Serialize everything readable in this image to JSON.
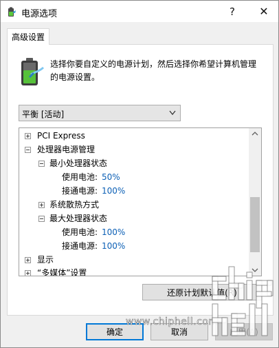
{
  "window": {
    "title": "电源选项",
    "help_glyph": "?",
    "close_glyph": "✕"
  },
  "tab": {
    "label": "高级设置"
  },
  "description": "选择你要自定义的电源计划，然后选择你希望计算机管理的电源设置。",
  "plan_dropdown": {
    "selected": "平衡 [活动]"
  },
  "tree": {
    "items": [
      {
        "label": "PCI Express"
      },
      {
        "label": "处理器电源管理"
      },
      {
        "label": "最小处理器状态"
      },
      {
        "key": "使用电池:",
        "value": "50%"
      },
      {
        "key": "接通电源:",
        "value": "100%"
      },
      {
        "label": "系统散热方式"
      },
      {
        "label": "最大处理器状态"
      },
      {
        "key": "使用电池:",
        "value": "100%"
      },
      {
        "key": "接通电源:",
        "value": "100%"
      },
      {
        "label": "显示"
      },
      {
        "label": "“多媒体”设置"
      }
    ]
  },
  "buttons": {
    "restore_defaults": "还原计划默认值(R)",
    "ok": "确定",
    "cancel": "取消",
    "apply": "应用(A)"
  },
  "watermark": {
    "text": "www.chiphell.com",
    "logo_text": "chip hell"
  },
  "colors": {
    "value_blue": "#0b5fb5",
    "focus_blue": "#0078d7"
  },
  "icons": {
    "app": "power-options-icon",
    "big": "battery-power-icon",
    "dropdown": "chevron-down-icon",
    "scroll_up": "scroll-up-arrow-icon",
    "scroll_down": "scroll-down-arrow-icon"
  }
}
